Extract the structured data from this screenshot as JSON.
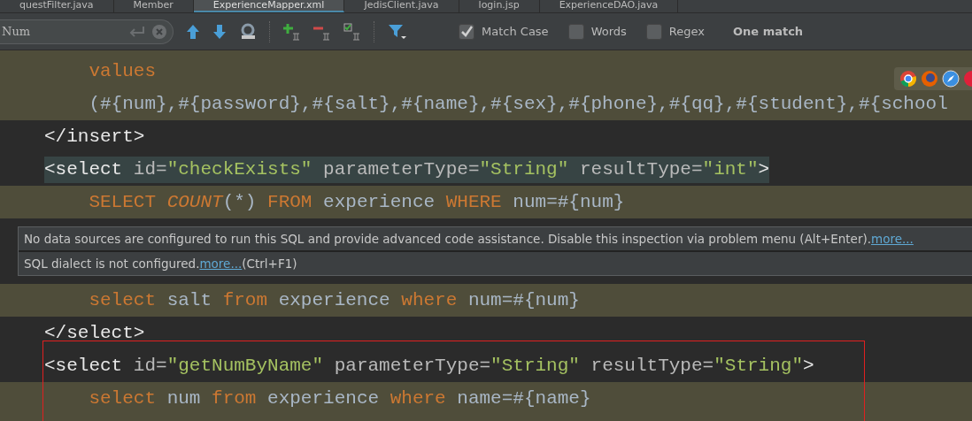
{
  "tabs": [
    {
      "label": "questFilter.java",
      "selected": false
    },
    {
      "label": "Member",
      "selected": false
    },
    {
      "label": "ExperienceMapper.xml",
      "selected": true
    },
    {
      "label": "JedisClient.java",
      "selected": false
    },
    {
      "label": "login.jsp",
      "selected": false
    },
    {
      "label": "ExperienceDAO.java",
      "selected": false
    }
  ],
  "search": {
    "value": "Num"
  },
  "options": [
    {
      "label": "Match Case",
      "checked": true
    },
    {
      "label": "Words",
      "checked": false
    },
    {
      "label": "Regex",
      "checked": false
    }
  ],
  "match_status": "One match",
  "code_lines": [
    {
      "kind": "sql",
      "segments": [
        {
          "text": "    values",
          "kind": "keyword"
        }
      ]
    },
    {
      "kind": "sql",
      "segments": [
        {
          "text": "    (#{num},#{password},#{salt},#{name},#{sex},#{phone},#{qq},#{student},#{school",
          "kind": "plain"
        }
      ]
    },
    {
      "kind": "tag",
      "highlighted": false,
      "segments": [
        {
          "text": "</insert>",
          "kind": "tag"
        }
      ]
    },
    {
      "kind": "tag",
      "highlighted": true,
      "segments": [
        {
          "text": "<select ",
          "kind": "tag"
        },
        {
          "text": "id=",
          "kind": "attr"
        },
        {
          "text": "\"checkExists\"",
          "kind": "value"
        },
        {
          "text": " parameterType=",
          "kind": "attr"
        },
        {
          "text": "\"String\"",
          "kind": "value"
        },
        {
          "text": " resultType=",
          "kind": "attr"
        },
        {
          "text": "\"int\"",
          "kind": "value"
        },
        {
          "text": ">",
          "kind": "tag"
        }
      ]
    },
    {
      "kind": "sql",
      "segments": [
        {
          "text": "    SELECT ",
          "kind": "keyword"
        },
        {
          "text": "COUNT",
          "kind": "func"
        },
        {
          "text": "(*) ",
          "kind": "plain"
        },
        {
          "text": "FROM ",
          "kind": "keyword"
        },
        {
          "text": "experience ",
          "kind": "plain"
        },
        {
          "text": "WHERE ",
          "kind": "keyword"
        },
        {
          "text": "num=#{num}",
          "kind": "plain"
        }
      ]
    },
    {
      "kind": "covered"
    },
    {
      "kind": "covered"
    },
    {
      "kind": "sql",
      "segments": [
        {
          "text": "    select ",
          "kind": "keyword"
        },
        {
          "text": "salt ",
          "kind": "plain"
        },
        {
          "text": "from ",
          "kind": "keyword"
        },
        {
          "text": "experience ",
          "kind": "plain"
        },
        {
          "text": "where ",
          "kind": "keyword"
        },
        {
          "text": "num=#{num}",
          "kind": "plain"
        }
      ]
    },
    {
      "kind": "tag",
      "highlighted": false,
      "segments": [
        {
          "text": "</select>",
          "kind": "tag"
        }
      ]
    },
    {
      "kind": "tag",
      "highlighted": false,
      "segments": [
        {
          "text": "<select ",
          "kind": "tag"
        },
        {
          "text": "id=",
          "kind": "attr"
        },
        {
          "text": "\"getNumByName\"",
          "kind": "value"
        },
        {
          "text": " parameterType=",
          "kind": "attr"
        },
        {
          "text": "\"String\"",
          "kind": "value"
        },
        {
          "text": " resultType=",
          "kind": "attr"
        },
        {
          "text": "\"String\"",
          "kind": "value"
        },
        {
          "text": ">",
          "kind": "tag"
        }
      ]
    },
    {
      "kind": "sql",
      "segments": [
        {
          "text": "    select ",
          "kind": "keyword"
        },
        {
          "text": "num ",
          "kind": "plain"
        },
        {
          "text": "from ",
          "kind": "keyword"
        },
        {
          "text": "experience ",
          "kind": "plain"
        },
        {
          "text": "where ",
          "kind": "keyword"
        },
        {
          "text": "name=#{name}",
          "kind": "plain"
        }
      ]
    }
  ],
  "tooltip": {
    "line_1": "No data sources are configured to run this SQL and provide advanced code assistance. Disable this inspection via problem menu (Alt+Enter).",
    "line_1_link": "more...",
    "line_2": "SQL dialect is not configured.",
    "line_2_link": "more...",
    "line_2_shortcut": "(Ctrl+F1)"
  }
}
